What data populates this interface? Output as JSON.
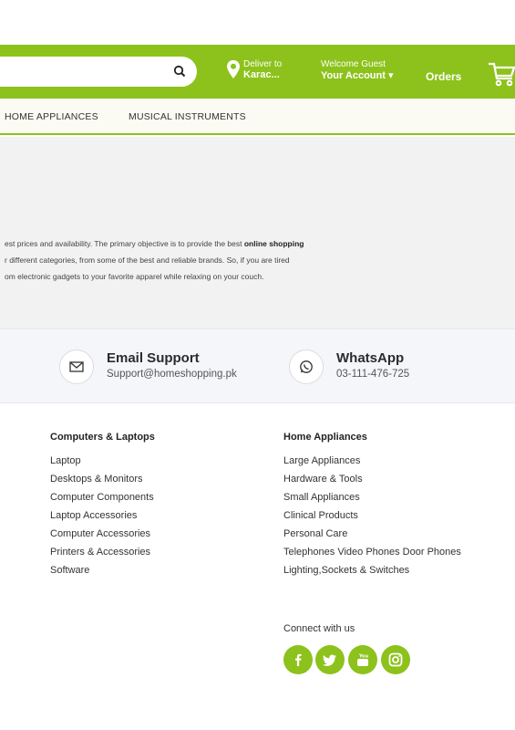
{
  "header": {
    "search_placeholder": "",
    "deliver_label": "Deliver to",
    "deliver_city": "Karac...",
    "welcome": "Welcome Guest",
    "account": "Your Account ▾",
    "orders": "Orders",
    "accent_color": "#8cc21b"
  },
  "categories": [
    "HOME APPLIANCES",
    "MUSICAL INSTRUMENTS"
  ],
  "intro": {
    "line1_pre": "est prices and availability. The primary objective is to provide the best ",
    "line1_bold": "online shopping",
    "line2": "r different categories, from some of the best and reliable brands. So, if you are tired",
    "line3": "om electronic gadgets to your favorite apparel while relaxing on your couch."
  },
  "support": {
    "email_title": "Email Support",
    "email_value": "Support@homeshopping.pk",
    "whatsapp_title": "WhatsApp",
    "whatsapp_value": "03-111-476-725"
  },
  "footer": {
    "col1": {
      "title": "Computers & Laptops",
      "items": [
        "Laptop",
        "Desktops & Monitors",
        "Computer Components",
        "Laptop Accessories",
        "Computer Accessories",
        "Printers & Accessories",
        "Software"
      ]
    },
    "col2": {
      "title": "Home Appliances",
      "items": [
        "Large Appliances",
        "Hardware & Tools",
        "Small Appliances",
        "Clinical Products",
        "Personal Care",
        "Telephones Video Phones Door Phones",
        "Lighting,Sockets & Switches"
      ]
    },
    "connect": "Connect with us",
    "social_icons": [
      "facebook-icon",
      "twitter-icon",
      "youtube-icon",
      "instagram-icon"
    ]
  }
}
